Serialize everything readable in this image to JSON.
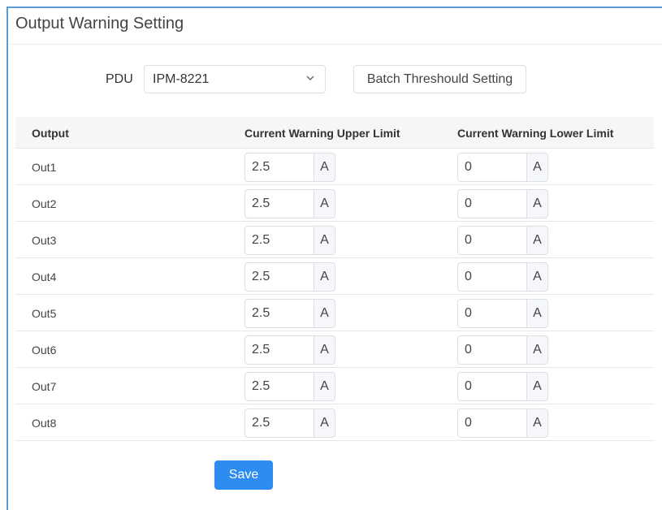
{
  "header": {
    "title": "Output Warning Setting"
  },
  "pdu": {
    "label": "PDU",
    "selected": "IPM-8221",
    "chevron_icon": "chevron-down-icon"
  },
  "toolbar": {
    "batch_label": "Batch Threshould Setting",
    "save_label": "Save"
  },
  "table": {
    "columns": [
      "Output",
      "Current Warning Upper Limit",
      "Current Warning Lower Limit"
    ],
    "unit": "A",
    "rows": [
      {
        "name": "Out1",
        "upper": "2.5",
        "lower": "0"
      },
      {
        "name": "Out2",
        "upper": "2.5",
        "lower": "0"
      },
      {
        "name": "Out3",
        "upper": "2.5",
        "lower": "0"
      },
      {
        "name": "Out4",
        "upper": "2.5",
        "lower": "0"
      },
      {
        "name": "Out5",
        "upper": "2.5",
        "lower": "0"
      },
      {
        "name": "Out6",
        "upper": "2.5",
        "lower": "0"
      },
      {
        "name": "Out7",
        "upper": "2.5",
        "lower": "0"
      },
      {
        "name": "Out8",
        "upper": "2.5",
        "lower": "0"
      }
    ]
  },
  "colors": {
    "accent": "#2d8cf0",
    "panel_border": "#5b9bd5"
  }
}
